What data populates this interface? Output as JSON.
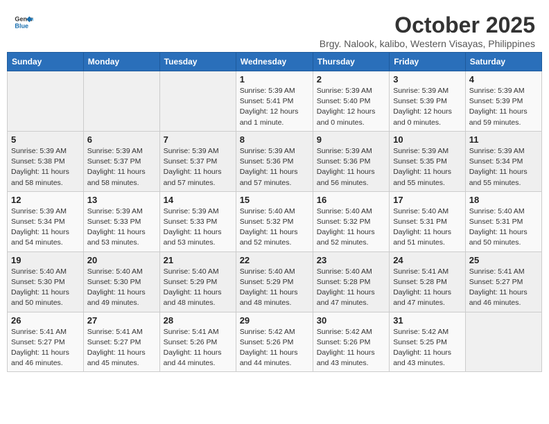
{
  "logo": {
    "line1": "General",
    "line2": "Blue"
  },
  "header": {
    "month": "October 2025",
    "location": "Brgy. Nalook, kalibo, Western Visayas, Philippines"
  },
  "weekdays": [
    "Sunday",
    "Monday",
    "Tuesday",
    "Wednesday",
    "Thursday",
    "Friday",
    "Saturday"
  ],
  "weeks": [
    [
      {
        "day": "",
        "info": ""
      },
      {
        "day": "",
        "info": ""
      },
      {
        "day": "",
        "info": ""
      },
      {
        "day": "1",
        "info": "Sunrise: 5:39 AM\nSunset: 5:41 PM\nDaylight: 12 hours\nand 1 minute."
      },
      {
        "day": "2",
        "info": "Sunrise: 5:39 AM\nSunset: 5:40 PM\nDaylight: 12 hours\nand 0 minutes."
      },
      {
        "day": "3",
        "info": "Sunrise: 5:39 AM\nSunset: 5:39 PM\nDaylight: 12 hours\nand 0 minutes."
      },
      {
        "day": "4",
        "info": "Sunrise: 5:39 AM\nSunset: 5:39 PM\nDaylight: 11 hours\nand 59 minutes."
      }
    ],
    [
      {
        "day": "5",
        "info": "Sunrise: 5:39 AM\nSunset: 5:38 PM\nDaylight: 11 hours\nand 58 minutes."
      },
      {
        "day": "6",
        "info": "Sunrise: 5:39 AM\nSunset: 5:37 PM\nDaylight: 11 hours\nand 58 minutes."
      },
      {
        "day": "7",
        "info": "Sunrise: 5:39 AM\nSunset: 5:37 PM\nDaylight: 11 hours\nand 57 minutes."
      },
      {
        "day": "8",
        "info": "Sunrise: 5:39 AM\nSunset: 5:36 PM\nDaylight: 11 hours\nand 57 minutes."
      },
      {
        "day": "9",
        "info": "Sunrise: 5:39 AM\nSunset: 5:36 PM\nDaylight: 11 hours\nand 56 minutes."
      },
      {
        "day": "10",
        "info": "Sunrise: 5:39 AM\nSunset: 5:35 PM\nDaylight: 11 hours\nand 55 minutes."
      },
      {
        "day": "11",
        "info": "Sunrise: 5:39 AM\nSunset: 5:34 PM\nDaylight: 11 hours\nand 55 minutes."
      }
    ],
    [
      {
        "day": "12",
        "info": "Sunrise: 5:39 AM\nSunset: 5:34 PM\nDaylight: 11 hours\nand 54 minutes."
      },
      {
        "day": "13",
        "info": "Sunrise: 5:39 AM\nSunset: 5:33 PM\nDaylight: 11 hours\nand 53 minutes."
      },
      {
        "day": "14",
        "info": "Sunrise: 5:39 AM\nSunset: 5:33 PM\nDaylight: 11 hours\nand 53 minutes."
      },
      {
        "day": "15",
        "info": "Sunrise: 5:40 AM\nSunset: 5:32 PM\nDaylight: 11 hours\nand 52 minutes."
      },
      {
        "day": "16",
        "info": "Sunrise: 5:40 AM\nSunset: 5:32 PM\nDaylight: 11 hours\nand 52 minutes."
      },
      {
        "day": "17",
        "info": "Sunrise: 5:40 AM\nSunset: 5:31 PM\nDaylight: 11 hours\nand 51 minutes."
      },
      {
        "day": "18",
        "info": "Sunrise: 5:40 AM\nSunset: 5:31 PM\nDaylight: 11 hours\nand 50 minutes."
      }
    ],
    [
      {
        "day": "19",
        "info": "Sunrise: 5:40 AM\nSunset: 5:30 PM\nDaylight: 11 hours\nand 50 minutes."
      },
      {
        "day": "20",
        "info": "Sunrise: 5:40 AM\nSunset: 5:30 PM\nDaylight: 11 hours\nand 49 minutes."
      },
      {
        "day": "21",
        "info": "Sunrise: 5:40 AM\nSunset: 5:29 PM\nDaylight: 11 hours\nand 48 minutes."
      },
      {
        "day": "22",
        "info": "Sunrise: 5:40 AM\nSunset: 5:29 PM\nDaylight: 11 hours\nand 48 minutes."
      },
      {
        "day": "23",
        "info": "Sunrise: 5:40 AM\nSunset: 5:28 PM\nDaylight: 11 hours\nand 47 minutes."
      },
      {
        "day": "24",
        "info": "Sunrise: 5:41 AM\nSunset: 5:28 PM\nDaylight: 11 hours\nand 47 minutes."
      },
      {
        "day": "25",
        "info": "Sunrise: 5:41 AM\nSunset: 5:27 PM\nDaylight: 11 hours\nand 46 minutes."
      }
    ],
    [
      {
        "day": "26",
        "info": "Sunrise: 5:41 AM\nSunset: 5:27 PM\nDaylight: 11 hours\nand 46 minutes."
      },
      {
        "day": "27",
        "info": "Sunrise: 5:41 AM\nSunset: 5:27 PM\nDaylight: 11 hours\nand 45 minutes."
      },
      {
        "day": "28",
        "info": "Sunrise: 5:41 AM\nSunset: 5:26 PM\nDaylight: 11 hours\nand 44 minutes."
      },
      {
        "day": "29",
        "info": "Sunrise: 5:42 AM\nSunset: 5:26 PM\nDaylight: 11 hours\nand 44 minutes."
      },
      {
        "day": "30",
        "info": "Sunrise: 5:42 AM\nSunset: 5:26 PM\nDaylight: 11 hours\nand 43 minutes."
      },
      {
        "day": "31",
        "info": "Sunrise: 5:42 AM\nSunset: 5:25 PM\nDaylight: 11 hours\nand 43 minutes."
      },
      {
        "day": "",
        "info": ""
      }
    ]
  ]
}
